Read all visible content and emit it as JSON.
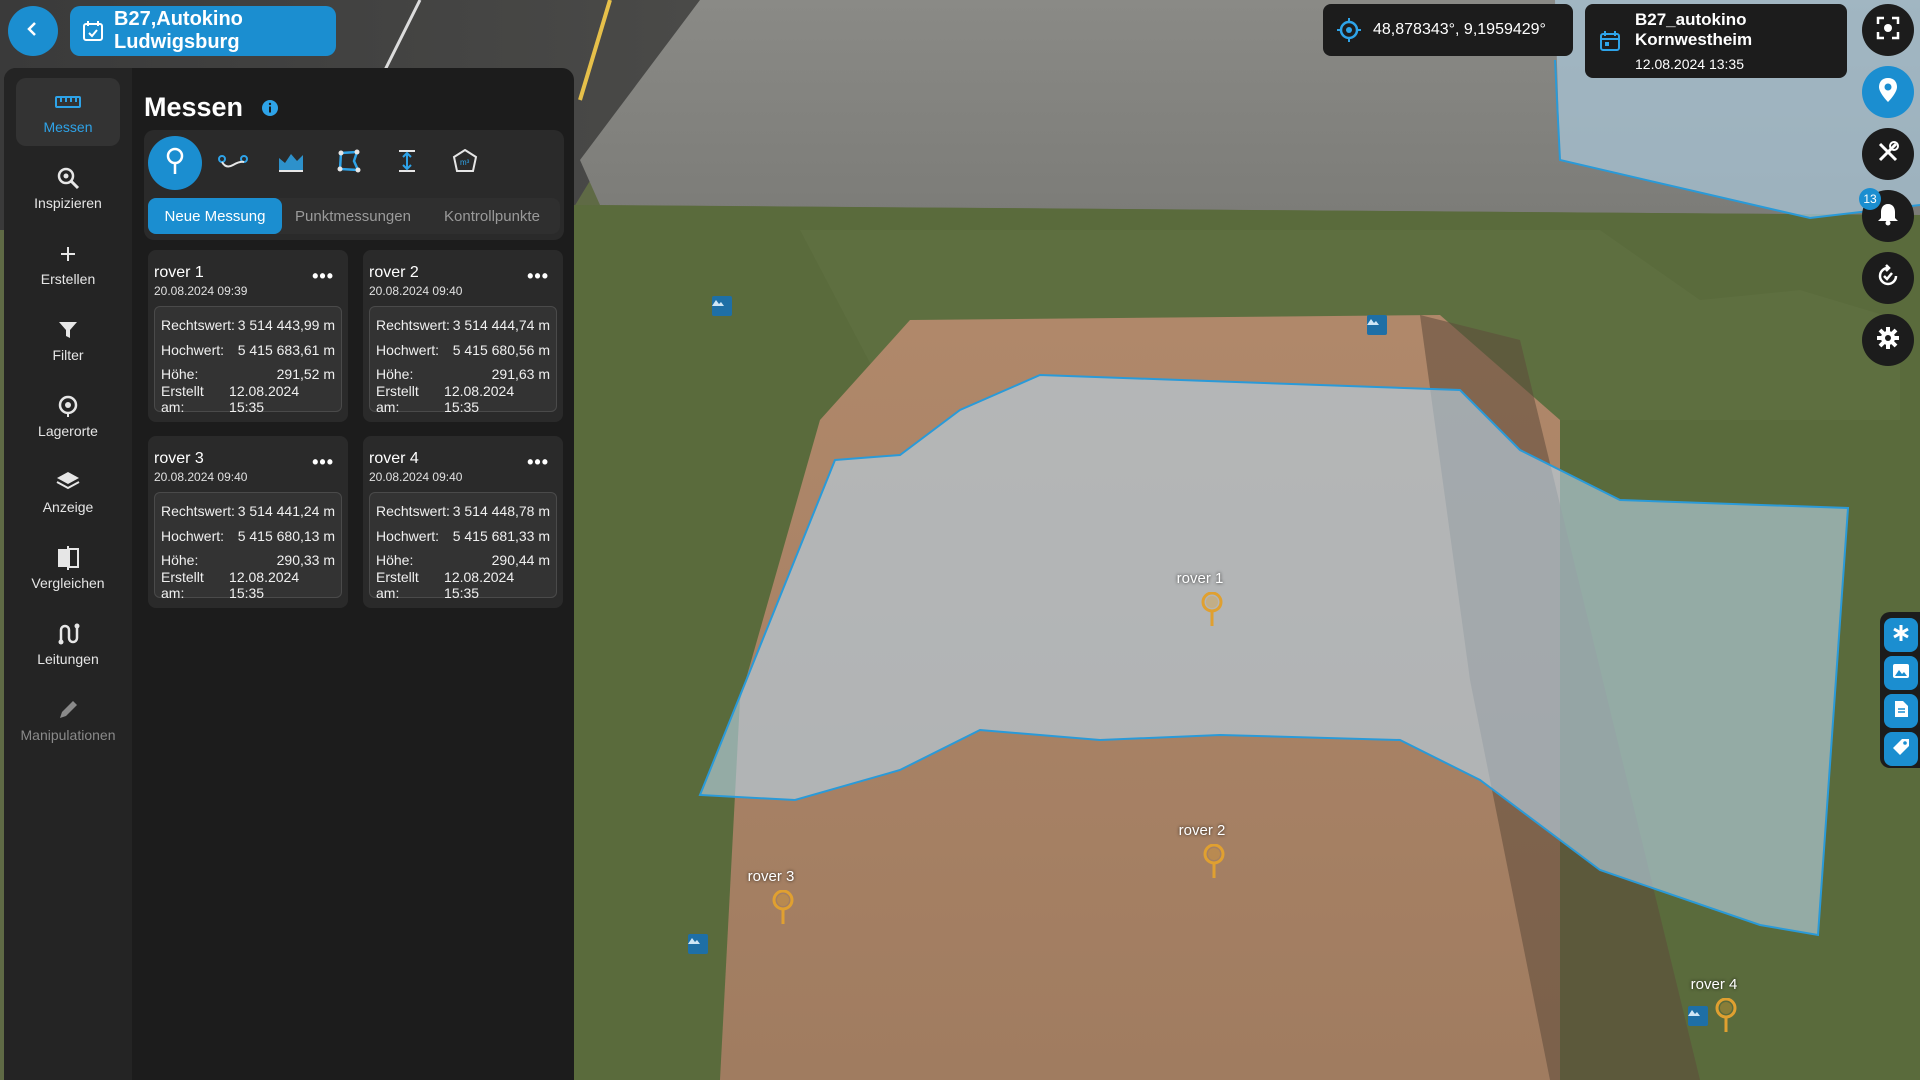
{
  "project": {
    "title": "B27,Autokino Ludwigsburg"
  },
  "rail": {
    "items": [
      {
        "label": "Messen",
        "icon": "ruler-icon"
      },
      {
        "label": "Inspizieren",
        "icon": "inspect-icon"
      },
      {
        "label": "Erstellen",
        "icon": "plus-icon"
      },
      {
        "label": "Filter",
        "icon": "filter-icon"
      },
      {
        "label": "Lagerorte",
        "icon": "location-icon"
      },
      {
        "label": "Anzeige",
        "icon": "layers-icon"
      },
      {
        "label": "Vergleichen",
        "icon": "compare-icon"
      },
      {
        "label": "Leitungen",
        "icon": "pipes-icon"
      },
      {
        "label": "Manipulationen",
        "icon": "pencil-icon"
      }
    ]
  },
  "panel": {
    "title": "Messen",
    "tools": [
      "point-pin-icon",
      "polyline-icon",
      "profile-icon",
      "area-icon",
      "height-icon",
      "volume-icon"
    ],
    "tabs": [
      "Neue Messung",
      "Punktmessungen",
      "Kontrollpunkte"
    ],
    "labels": {
      "rechtswert": "Rechtswert:",
      "hochwert": "Hochwert:",
      "hoehe": "Höhe:",
      "erstellt": "Erstellt am:"
    },
    "measurements": [
      {
        "name": "rover 1",
        "date": "20.08.2024 09:39",
        "rechtswert": "3 514 443,99 m",
        "hochwert": "5 415 683,61 m",
        "hoehe": "291,52 m",
        "erstellt": "12.08.2024 15:35"
      },
      {
        "name": "rover 2",
        "date": "20.08.2024 09:40",
        "rechtswert": "3 514 444,74 m",
        "hochwert": "5 415 680,56 m",
        "hoehe": "291,63 m",
        "erstellt": "12.08.2024 15:35"
      },
      {
        "name": "rover 3",
        "date": "20.08.2024 09:40",
        "rechtswert": "3 514 441,24 m",
        "hochwert": "5 415 680,13 m",
        "hoehe": "290,33 m",
        "erstellt": "12.08.2024 15:35"
      },
      {
        "name": "rover 4",
        "date": "20.08.2024 09:40",
        "rechtswert": "3 514 448,78 m",
        "hochwert": "5 415 681,33 m",
        "hoehe": "290,44 m",
        "erstellt": "12.08.2024 15:35"
      }
    ]
  },
  "header": {
    "coordinates": "48,878343°, 9,1959429°",
    "dataset_title": "B27_autokino Kornwestheim",
    "dataset_date": "12.08.2024 13:35"
  },
  "notifications": {
    "count": "13"
  },
  "map": {
    "markers": [
      "rover 1",
      "rover 2",
      "rover 3",
      "rover 4"
    ]
  },
  "colors": {
    "accent": "#1b8ed0",
    "panel": "#1c1c1c",
    "marker": "#e0a030"
  }
}
